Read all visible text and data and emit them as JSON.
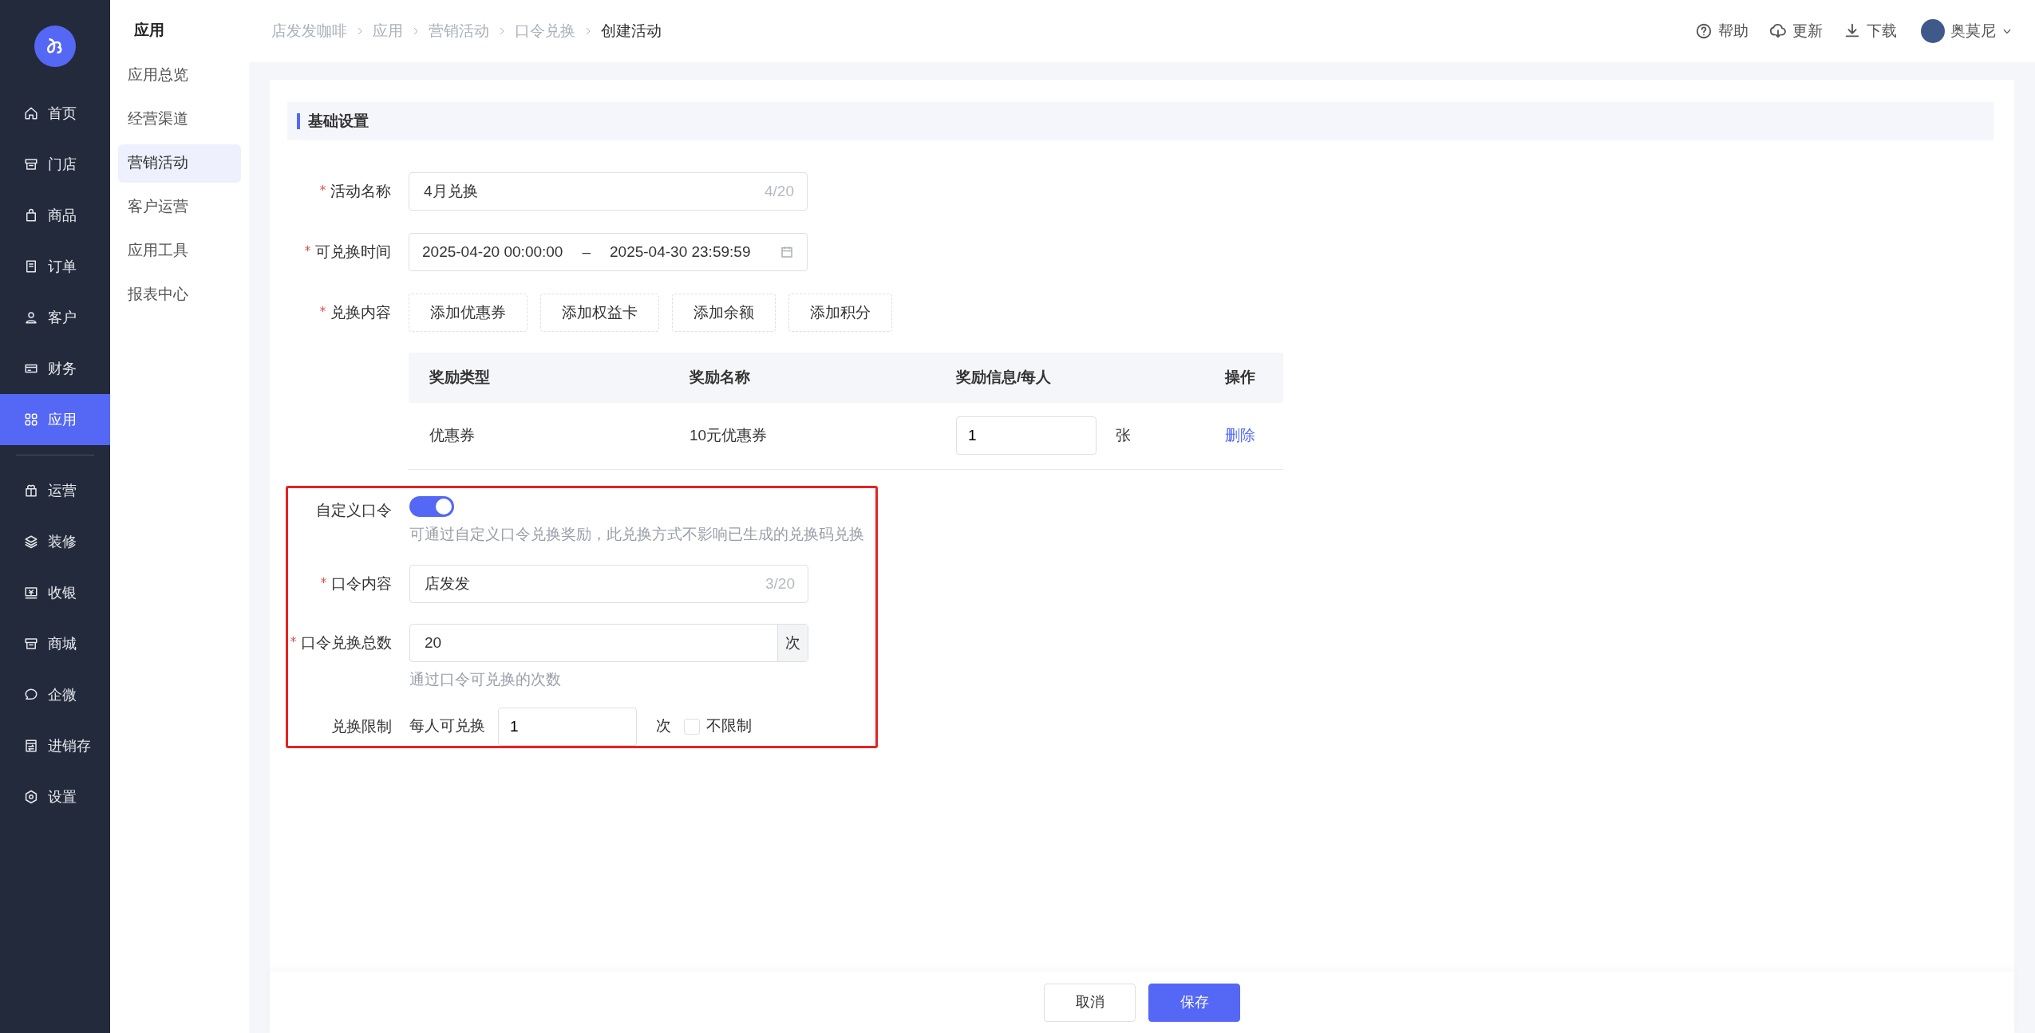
{
  "sidebar": {
    "primary_items": [
      {
        "label": "首页",
        "selected": false
      },
      {
        "label": "门店",
        "selected": false
      },
      {
        "label": "商品",
        "selected": false
      },
      {
        "label": "订单",
        "selected": false
      },
      {
        "label": "客户",
        "selected": false
      },
      {
        "label": "财务",
        "selected": false
      },
      {
        "label": "应用",
        "selected": true
      }
    ],
    "secondary_items": [
      {
        "label": "运营",
        "selected": false
      },
      {
        "label": "装修",
        "selected": false
      },
      {
        "label": "收银",
        "selected": false
      },
      {
        "label": "商城",
        "selected": false
      },
      {
        "label": "企微",
        "selected": false
      },
      {
        "label": "进销存",
        "selected": false
      },
      {
        "label": "设置",
        "selected": false
      }
    ]
  },
  "submenu": {
    "title": "应用",
    "items": [
      {
        "label": "应用总览",
        "selected": false
      },
      {
        "label": "经营渠道",
        "selected": false
      },
      {
        "label": "营销活动",
        "selected": true
      },
      {
        "label": "客户运营",
        "selected": false
      },
      {
        "label": "应用工具",
        "selected": false
      },
      {
        "label": "报表中心",
        "selected": false
      }
    ]
  },
  "breadcrumb": [
    "店发发咖啡",
    "应用",
    "营销活动",
    "口令兑换",
    "创建活动"
  ],
  "header_actions": [
    {
      "label": "帮助",
      "kind": "help"
    },
    {
      "label": "更新",
      "kind": "update"
    },
    {
      "label": "下载",
      "kind": "download"
    }
  ],
  "user": {
    "name": "奥莫尼"
  },
  "section": {
    "title": "基础设置"
  },
  "form": {
    "activity_name": {
      "label": "活动名称",
      "required": true,
      "value": "4月兑换",
      "counter": "4/20"
    },
    "exchange_time": {
      "label": "可兑换时间",
      "required": true,
      "start": "2025-04-20 00:00:00",
      "separator": "–",
      "end": "2025-04-30 23:59:59"
    },
    "exchange_content": {
      "label": "兑换内容",
      "required": true,
      "add_buttons": [
        "添加优惠券",
        "添加权益卡",
        "添加余额",
        "添加积分"
      ],
      "table": {
        "columns": [
          "奖励类型",
          "奖励名称",
          "奖励信息/每人",
          "操作"
        ],
        "rows": [
          {
            "type": "优惠券",
            "name": "10元优惠券",
            "quantity": "1",
            "unit": "张",
            "action": "删除"
          }
        ]
      }
    },
    "password_section": {
      "highlighted": true,
      "custom_password": {
        "label": "自定义口令",
        "required": false,
        "on": true,
        "hint": "可通过自定义口令兑换奖励，此兑换方式不影响已生成的兑换码兑换"
      },
      "password_content": {
        "label": "口令内容",
        "required": true,
        "value": "店发发",
        "counter": "3/20"
      },
      "total": {
        "label": "口令兑换总数",
        "required": true,
        "value": "20",
        "suffix": "次",
        "hint": "通过口令可兑换的次数"
      },
      "limit": {
        "label": "兑换限制",
        "required": false,
        "prefix": "每人可兑换",
        "value": "1",
        "unit": "次",
        "unlimited": {
          "label": "不限制",
          "checked": false
        }
      }
    }
  },
  "footer_buttons": [
    {
      "label": "取消",
      "kind": "secondary"
    },
    {
      "label": "保存",
      "kind": "primary"
    }
  ]
}
